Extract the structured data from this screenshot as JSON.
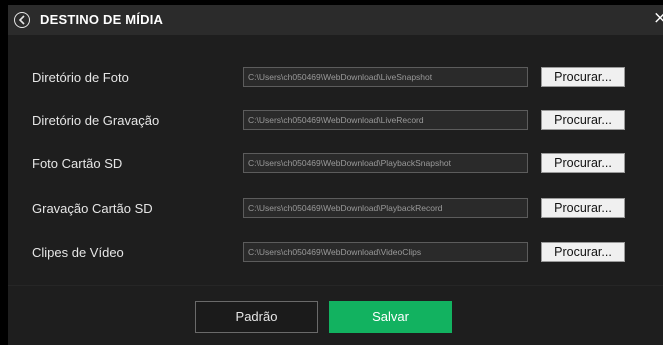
{
  "dialog": {
    "title": "DESTINO DE MÍDIA",
    "close_label": "×"
  },
  "rows": [
    {
      "label": "Diretório de Foto",
      "path": "C:\\Users\\ch050469\\WebDownload\\LiveSnapshot",
      "button": "Procurar..."
    },
    {
      "label": "Diretório de Gravação",
      "path": "C:\\Users\\ch050469\\WebDownload\\LiveRecord",
      "button": "Procurar..."
    },
    {
      "label": "Foto Cartão SD",
      "path": "C:\\Users\\ch050469\\WebDownload\\PlaybackSnapshot",
      "button": "Procurar..."
    },
    {
      "label": "Gravação Cartão SD",
      "path": "C:\\Users\\ch050469\\WebDownload\\PlaybackRecord",
      "button": "Procurar..."
    },
    {
      "label": "Clipes de Vídeo",
      "path": "C:\\Users\\ch050469\\WebDownload\\VideoClips",
      "button": "Procurar..."
    }
  ],
  "footer": {
    "default_label": "Padrão",
    "save_label": "Salvar"
  },
  "colors": {
    "background": "#1e1e1e",
    "header": "#2b2b2b",
    "accent_save": "#12b260"
  },
  "icons": {
    "back": "back-arrow-circle-icon",
    "close": "close-icon"
  }
}
